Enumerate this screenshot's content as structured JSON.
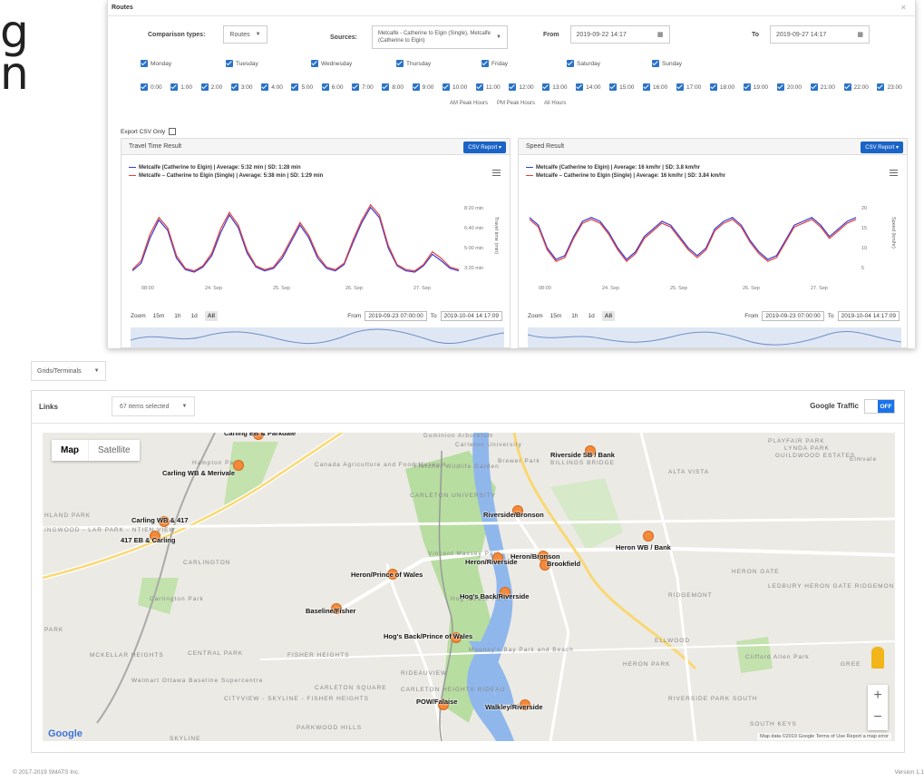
{
  "background_title": "g\nn",
  "routes_window": {
    "title": "Routes",
    "comparison_label": "Comparison types:",
    "comparison_value": "Routes",
    "sources_label": "Sources:",
    "sources_value": "Metcalfe - Catherine to Elgin (Single), Metcalfe (Catherine to Elgin)",
    "from_label": "From",
    "from_value": "2019-09-22 14:17",
    "to_label": "To",
    "to_value": "2019-09-27 14:17",
    "days": [
      "Monday",
      "Tuesday",
      "Wednesday",
      "Thursday",
      "Friday",
      "Saturday",
      "Sunday"
    ],
    "hours": [
      "0:00",
      "1:00",
      "2:00",
      "3:00",
      "4:00",
      "5:00",
      "6:00",
      "7:00",
      "8:00",
      "9:00",
      "10:00",
      "11:00",
      "12:00",
      "13:00",
      "14:00",
      "15:00",
      "16:00",
      "17:00",
      "18:00",
      "19:00",
      "20:00",
      "21:00",
      "22:00",
      "23:00"
    ],
    "peak_links": [
      "AM Peak Hours",
      "PM Peak Hours",
      "All Hours"
    ],
    "export_csv_label": "Export CSV Only"
  },
  "travel_panel": {
    "title": "Travel Time Result",
    "csv_button": "CSV Report ▾",
    "legend_1": "Metcalfe (Catherine to Elgin) | Average: 5:32 min | SD: 1:28 min",
    "legend_2": "Metcalfe – Catherine to Elgin (Single) | Average: 5:38 min | SD: 1:29 min",
    "y_ticks": [
      "8:20 min",
      "6:40 min",
      "5:00 min",
      "3:20 min"
    ],
    "y_label": "Travel time (min)",
    "x_ticks": [
      "08:00",
      "24. Sep",
      "25. Sep",
      "26. Sep",
      "27. Sep"
    ],
    "zoom_label": "Zoom",
    "zoom_buttons": [
      "15m",
      "1h",
      "1d",
      "All"
    ],
    "from_label": "From",
    "from_value": "2019-09-23 07:00:00",
    "to_label": "To",
    "to_value": "2019-10-04 14:17:09"
  },
  "speed_panel": {
    "title": "Speed Result",
    "csv_button": "CSV Report ▾",
    "legend_1": "Metcalfe (Catherine to Elgin) | Average: 16 km/hr | SD: 3.8 km/hr",
    "legend_2": "Metcalfe – Catherine to Elgin (Single) | Average: 16 km/hr | SD: 3.84 km/hr",
    "y_ticks": [
      "20",
      "15",
      "10",
      "5"
    ],
    "y_label": "Speed (km/hr)",
    "x_ticks": [
      "08:00",
      "24. Sep",
      "25. Sep",
      "26. Sep",
      "27. Sep"
    ],
    "zoom_label": "Zoom",
    "zoom_buttons": [
      "15m",
      "1h",
      "1d",
      "All"
    ],
    "from_label": "From",
    "from_value": "2019-09-23 07:00:00",
    "to_label": "To",
    "to_value": "2019-10-04 14:17:09"
  },
  "chart_data": [
    {
      "type": "line",
      "ylabel": "Travel time (min)",
      "x_ticks": [
        "08:00",
        "24. Sep",
        "25. Sep",
        "26. Sep",
        "27. Sep"
      ],
      "y_ticks": [
        "8:20 min",
        "6:40 min",
        "5:00 min",
        "3:20 min"
      ],
      "ylim": [
        3.0,
        9.0
      ],
      "series": [
        {
          "name": "Metcalfe (Catherine to Elgin)",
          "color": "#3a3ad6",
          "values": [
            3.6,
            4.2,
            6.2,
            7.6,
            6.8,
            4.6,
            3.7,
            3.5,
            3.9,
            4.8,
            6.6,
            8.0,
            7.0,
            5.0,
            3.9,
            3.6,
            3.8,
            4.6,
            5.9,
            7.2,
            6.2,
            4.6,
            3.8,
            3.6,
            4.1,
            5.8,
            7.4,
            8.6,
            7.8,
            5.4,
            4.0,
            3.6,
            3.5,
            4.0,
            4.9,
            4.4,
            3.8,
            3.6
          ]
        },
        {
          "name": "Metcalfe – Catherine to Elgin (Single)",
          "color": "#e0413d",
          "values": [
            3.7,
            4.4,
            6.5,
            7.8,
            7.0,
            4.8,
            3.8,
            3.6,
            4.0,
            5.0,
            6.9,
            8.2,
            7.2,
            5.2,
            4.0,
            3.7,
            3.9,
            4.8,
            6.1,
            7.4,
            6.4,
            4.8,
            3.9,
            3.7,
            4.2,
            6.0,
            7.6,
            8.8,
            8.0,
            5.6,
            4.1,
            3.7,
            3.6,
            4.1,
            5.1,
            4.6,
            3.9,
            3.7
          ]
        }
      ]
    },
    {
      "type": "line",
      "ylabel": "Speed (km/hr)",
      "x_ticks": [
        "08:00",
        "24. Sep",
        "25. Sep",
        "26. Sep",
        "27. Sep"
      ],
      "y_ticks": [
        "20",
        "15",
        "10",
        "5"
      ],
      "ylim": [
        4,
        24
      ],
      "series": [
        {
          "name": "Metcalfe (Catherine to Elgin)",
          "color": "#3a3ad6",
          "values": [
            20,
            18,
            12,
            9,
            10,
            15,
            19,
            20,
            19,
            16,
            12,
            9,
            11,
            15,
            17,
            19,
            18,
            15,
            12,
            10,
            12,
            17,
            19,
            20,
            18,
            14,
            11,
            9,
            10,
            14,
            18,
            19,
            20,
            18,
            15,
            17,
            19,
            20
          ]
        },
        {
          "name": "Metcalfe – Catherine to Elgin (Single)",
          "color": "#e0413d",
          "values": [
            19.5,
            17.5,
            11.5,
            8.5,
            9.5,
            14.5,
            18.5,
            19.5,
            18.5,
            15.5,
            11.5,
            8.5,
            10.5,
            14.5,
            16.5,
            18.5,
            17.5,
            14.5,
            11.5,
            9.5,
            11.5,
            16.5,
            18.5,
            19.5,
            17.5,
            13.5,
            10.5,
            8.5,
            9.5,
            13.5,
            17.5,
            18.5,
            19.5,
            17.5,
            14.5,
            16.5,
            18.5,
            19.5
          ]
        }
      ]
    }
  ],
  "bottom": {
    "grid_select": "Grids/Terminals",
    "links_label": "Links",
    "items_selected": "67 items selected",
    "google_traffic_label": "Google Traffic",
    "toggle_state": "OFF",
    "map_type_map": "Map",
    "map_type_satellite": "Satellite",
    "google_logo": "Google",
    "attribution": "Map data ©2019 Google   Terms of Use   Report a map error"
  },
  "map_labels": {
    "intersections": [
      "Carling EB & Parkdale",
      "Carling WB & Merivale",
      "Carling WB & 417",
      "417 EB & Carling",
      "Riverside SB / Bank",
      "Riverside/Bronson",
      "Heron WB / Bank",
      "Heron/Bronson",
      "Heron/Riverside",
      "Heron/Prince of Wales",
      "Brookfield",
      "Hog's Back/Riverside",
      "Baseline/Fisher",
      "Hog's Back/Prince of Wales",
      "POW/Falaise",
      "Walkley/Riverside"
    ],
    "neighbourhoods": [
      "PLAYFAIR PARK",
      "LYNDA PARK",
      "GUILDWOOD ESTATES",
      "ALTA VISTA",
      "BILLINGS BRIDGE",
      "CARLETON UNIVERSITY",
      "CARLINGTON",
      "HERON GATE",
      "RIDGEMONT",
      "LEDBURY HERON GATE RIDGEMONT ELMWOOD",
      "CENTRAL PARK",
      "FISHER HEIGHTS",
      "MCKELLAR HEIGHTS",
      "RIDEAUVIEW",
      "CARLETON SQUARE",
      "CARLETON HEIGHTS RIDEAU",
      "CITYVIEW - SKYLINE - FISHER HEIGHTS",
      "ELLWOOD",
      "HERON PARK",
      "RIVERSIDE PARK SOUTH",
      "SOUTH KEYS",
      "PARKWOOD HILLS",
      "SKYLINE",
      "HLAND PARK",
      "INGWOOD - LAR PARK - NTIEN VIEW",
      "PARK",
      "GREE",
      "Carleton University",
      "Brewer Park",
      "Canada Agriculture and Food Museum",
      "Fletcher Wildlife Garden",
      "Vincent Massey Park",
      "Hog's Back Park",
      "Mooney's Bay Park and Beach",
      "Walmart Ottawa Baseline Supercentre",
      "Clifford Allen Park",
      "Carlington Park",
      "Hampton Park",
      "Dominion Arboretum",
      "Elmvale"
    ]
  },
  "footer": {
    "copyright": "© 2017-2019 SMATS Inc.",
    "version": "Version 1.1"
  }
}
